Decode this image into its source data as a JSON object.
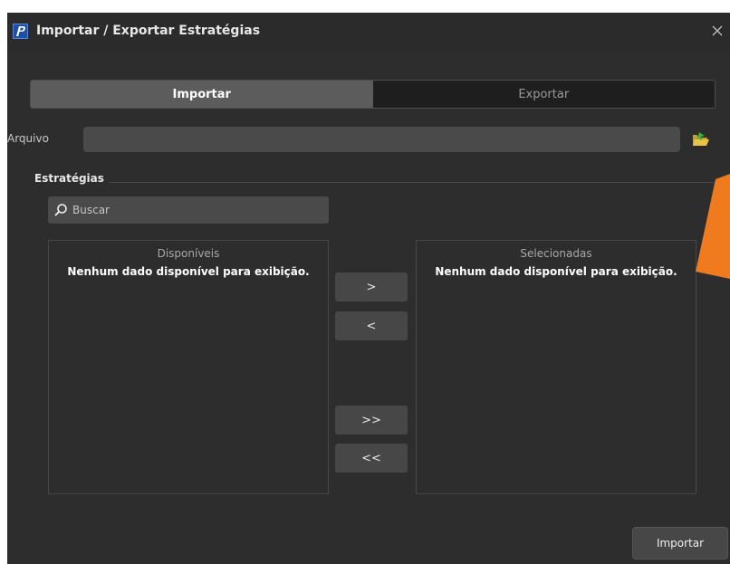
{
  "window": {
    "title": "Importar / Exportar Estratégias",
    "app_icon": "profit-p-logo-icon",
    "close_icon": "close-icon"
  },
  "tabs": [
    {
      "label": "Importar",
      "active": true
    },
    {
      "label": "Exportar",
      "active": false
    }
  ],
  "file": {
    "label": "Arquivo",
    "value": "",
    "browse_icon": "folder-open-icon"
  },
  "strategies": {
    "section_title": "Estratégias",
    "search": {
      "placeholder": "Buscar",
      "value": "",
      "icon": "search-icon"
    },
    "available": {
      "header": "Disponíveis",
      "empty_message": "Nenhum dado disponível para exibição."
    },
    "selected": {
      "header": "Selecionadas",
      "empty_message": "Nenhum dado disponível para exibição."
    },
    "buttons": {
      "add": ">",
      "remove": "<",
      "add_all": ">>",
      "remove_all": "<<"
    }
  },
  "footer": {
    "import_button": "Importar"
  },
  "colors": {
    "background": "#2d2d2d",
    "active_tab": "#5c5c5c",
    "inactive_tab": "#1e1e1e",
    "input": "#4a4a4a",
    "annotation_arrow": "#f07a1e"
  }
}
